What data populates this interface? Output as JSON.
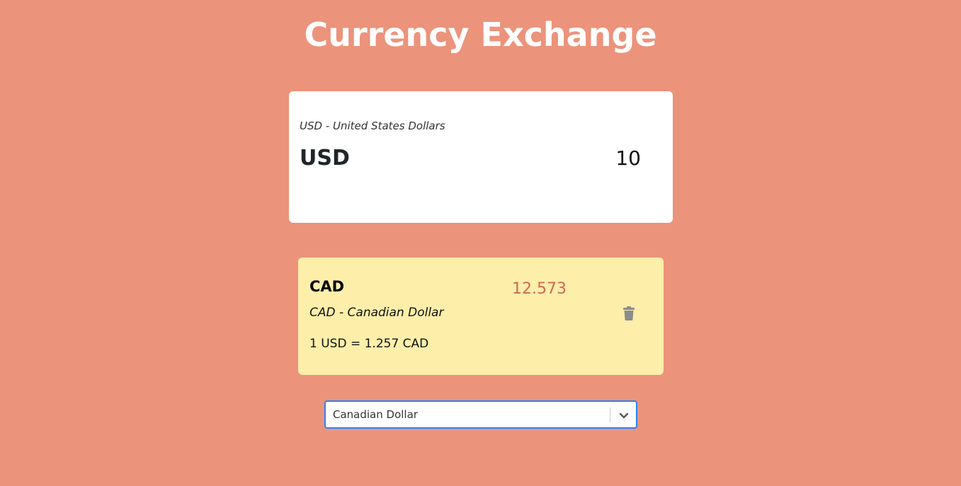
{
  "header": {
    "title": "Currency Exchange"
  },
  "base": {
    "name": "USD - United States Dollars",
    "code": "USD",
    "amount": "10"
  },
  "targets": [
    {
      "code": "CAD",
      "value": "12.573",
      "name": "CAD - Canadian Dollar",
      "rate": "1 USD = 1.257 CAD"
    }
  ],
  "currency_select": {
    "value": "Canadian Dollar"
  },
  "colors": {
    "background": "#ec937b",
    "base_card": "#ffffff",
    "target_card": "#fdeeaa",
    "target_value": "#cd6b52",
    "select_focus": "#2684ff"
  },
  "icons": {
    "delete": "trash-icon",
    "dropdown": "chevron-down-icon"
  }
}
